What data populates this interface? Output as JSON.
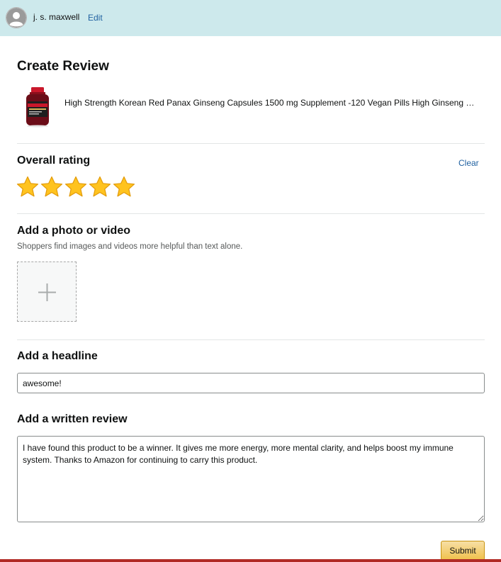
{
  "header": {
    "avatar_icon": "user-avatar-icon",
    "username": "j. s. maxwell",
    "edit_label": "Edit"
  },
  "page_title": "Create Review",
  "product": {
    "image_icon": "supplement-bottle-icon",
    "name": "High Strength Korean Red Panax Ginseng Capsules 1500 mg Supplement -120 Vegan Pills High Ginseng Extract"
  },
  "rating": {
    "title": "Overall rating",
    "clear_label": "Clear",
    "value": 5,
    "max": 5,
    "star_color": "#ffc31f"
  },
  "media": {
    "title": "Add a photo or video",
    "subtitle": "Shoppers find images and videos more helpful than text alone.",
    "upload_icon": "plus-icon"
  },
  "headline": {
    "title": "Add a headline",
    "value": "awesome!"
  },
  "review": {
    "title": "Add a written review",
    "value": "I have found this product to be a winner. It gives me more energy, more mental clarity, and helps boost my immune system. Thanks to Amazon for continuing to carry this product."
  },
  "submit_label": "Submit",
  "colors": {
    "header_bg": "#cde9ec",
    "link": "#2162a1",
    "button": "#f0c14b"
  }
}
